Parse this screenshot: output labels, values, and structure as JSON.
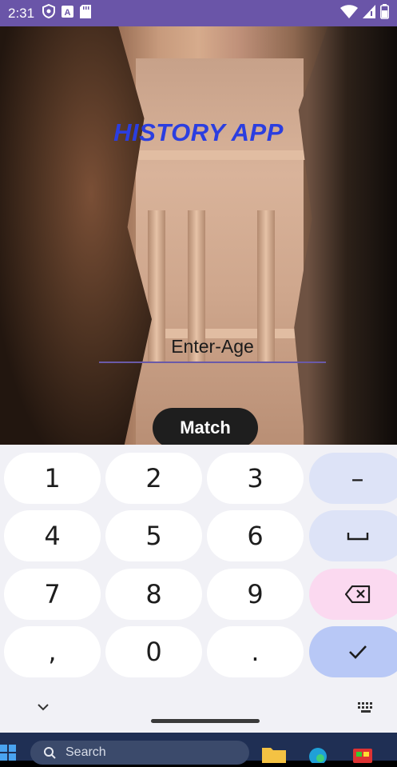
{
  "status_bar": {
    "time": "2:31",
    "icons_left": [
      "shield-icon",
      "a-letter-icon",
      "sd-card-icon"
    ],
    "icons_right": [
      "wifi-icon",
      "signal-icon",
      "battery-icon"
    ]
  },
  "app": {
    "title": "HISTORY APP",
    "age_input": {
      "placeholder": "Enter-Age",
      "value": ""
    },
    "match_button": "Match"
  },
  "keyboard": {
    "rows": [
      [
        "1",
        "2",
        "3",
        "–"
      ],
      [
        "4",
        "5",
        "6",
        "␣"
      ],
      [
        "7",
        "8",
        "9",
        "⌫"
      ],
      [
        ",",
        "0",
        ".",
        "✓"
      ]
    ],
    "hide_icon": "chevron-down-icon",
    "switch_icon": "keyboard-grid-icon"
  },
  "taskbar": {
    "search_label": "Search",
    "icons": [
      "windows-logo-icon",
      "folder-icon",
      "edge-icon",
      "store-icon"
    ]
  }
}
